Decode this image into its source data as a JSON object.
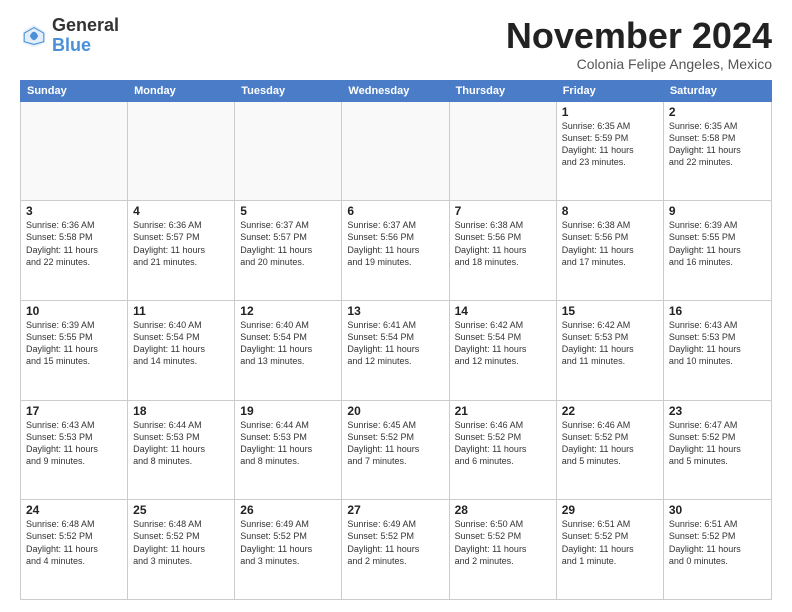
{
  "logo": {
    "general": "General",
    "blue": "Blue"
  },
  "title": "November 2024",
  "subtitle": "Colonia Felipe Angeles, Mexico",
  "days": [
    "Sunday",
    "Monday",
    "Tuesday",
    "Wednesday",
    "Thursday",
    "Friday",
    "Saturday"
  ],
  "rows": [
    [
      {
        "day": "",
        "content": "",
        "empty": true
      },
      {
        "day": "",
        "content": "",
        "empty": true
      },
      {
        "day": "",
        "content": "",
        "empty": true
      },
      {
        "day": "",
        "content": "",
        "empty": true
      },
      {
        "day": "",
        "content": "",
        "empty": true
      },
      {
        "day": "1",
        "content": "Sunrise: 6:35 AM\nSunset: 5:59 PM\nDaylight: 11 hours\nand 23 minutes.",
        "empty": false
      },
      {
        "day": "2",
        "content": "Sunrise: 6:35 AM\nSunset: 5:58 PM\nDaylight: 11 hours\nand 22 minutes.",
        "empty": false
      }
    ],
    [
      {
        "day": "3",
        "content": "Sunrise: 6:36 AM\nSunset: 5:58 PM\nDaylight: 11 hours\nand 22 minutes.",
        "empty": false
      },
      {
        "day": "4",
        "content": "Sunrise: 6:36 AM\nSunset: 5:57 PM\nDaylight: 11 hours\nand 21 minutes.",
        "empty": false
      },
      {
        "day": "5",
        "content": "Sunrise: 6:37 AM\nSunset: 5:57 PM\nDaylight: 11 hours\nand 20 minutes.",
        "empty": false
      },
      {
        "day": "6",
        "content": "Sunrise: 6:37 AM\nSunset: 5:56 PM\nDaylight: 11 hours\nand 19 minutes.",
        "empty": false
      },
      {
        "day": "7",
        "content": "Sunrise: 6:38 AM\nSunset: 5:56 PM\nDaylight: 11 hours\nand 18 minutes.",
        "empty": false
      },
      {
        "day": "8",
        "content": "Sunrise: 6:38 AM\nSunset: 5:56 PM\nDaylight: 11 hours\nand 17 minutes.",
        "empty": false
      },
      {
        "day": "9",
        "content": "Sunrise: 6:39 AM\nSunset: 5:55 PM\nDaylight: 11 hours\nand 16 minutes.",
        "empty": false
      }
    ],
    [
      {
        "day": "10",
        "content": "Sunrise: 6:39 AM\nSunset: 5:55 PM\nDaylight: 11 hours\nand 15 minutes.",
        "empty": false
      },
      {
        "day": "11",
        "content": "Sunrise: 6:40 AM\nSunset: 5:54 PM\nDaylight: 11 hours\nand 14 minutes.",
        "empty": false
      },
      {
        "day": "12",
        "content": "Sunrise: 6:40 AM\nSunset: 5:54 PM\nDaylight: 11 hours\nand 13 minutes.",
        "empty": false
      },
      {
        "day": "13",
        "content": "Sunrise: 6:41 AM\nSunset: 5:54 PM\nDaylight: 11 hours\nand 12 minutes.",
        "empty": false
      },
      {
        "day": "14",
        "content": "Sunrise: 6:42 AM\nSunset: 5:54 PM\nDaylight: 11 hours\nand 12 minutes.",
        "empty": false
      },
      {
        "day": "15",
        "content": "Sunrise: 6:42 AM\nSunset: 5:53 PM\nDaylight: 11 hours\nand 11 minutes.",
        "empty": false
      },
      {
        "day": "16",
        "content": "Sunrise: 6:43 AM\nSunset: 5:53 PM\nDaylight: 11 hours\nand 10 minutes.",
        "empty": false
      }
    ],
    [
      {
        "day": "17",
        "content": "Sunrise: 6:43 AM\nSunset: 5:53 PM\nDaylight: 11 hours\nand 9 minutes.",
        "empty": false
      },
      {
        "day": "18",
        "content": "Sunrise: 6:44 AM\nSunset: 5:53 PM\nDaylight: 11 hours\nand 8 minutes.",
        "empty": false
      },
      {
        "day": "19",
        "content": "Sunrise: 6:44 AM\nSunset: 5:53 PM\nDaylight: 11 hours\nand 8 minutes.",
        "empty": false
      },
      {
        "day": "20",
        "content": "Sunrise: 6:45 AM\nSunset: 5:52 PM\nDaylight: 11 hours\nand 7 minutes.",
        "empty": false
      },
      {
        "day": "21",
        "content": "Sunrise: 6:46 AM\nSunset: 5:52 PM\nDaylight: 11 hours\nand 6 minutes.",
        "empty": false
      },
      {
        "day": "22",
        "content": "Sunrise: 6:46 AM\nSunset: 5:52 PM\nDaylight: 11 hours\nand 5 minutes.",
        "empty": false
      },
      {
        "day": "23",
        "content": "Sunrise: 6:47 AM\nSunset: 5:52 PM\nDaylight: 11 hours\nand 5 minutes.",
        "empty": false
      }
    ],
    [
      {
        "day": "24",
        "content": "Sunrise: 6:48 AM\nSunset: 5:52 PM\nDaylight: 11 hours\nand 4 minutes.",
        "empty": false
      },
      {
        "day": "25",
        "content": "Sunrise: 6:48 AM\nSunset: 5:52 PM\nDaylight: 11 hours\nand 3 minutes.",
        "empty": false
      },
      {
        "day": "26",
        "content": "Sunrise: 6:49 AM\nSunset: 5:52 PM\nDaylight: 11 hours\nand 3 minutes.",
        "empty": false
      },
      {
        "day": "27",
        "content": "Sunrise: 6:49 AM\nSunset: 5:52 PM\nDaylight: 11 hours\nand 2 minutes.",
        "empty": false
      },
      {
        "day": "28",
        "content": "Sunrise: 6:50 AM\nSunset: 5:52 PM\nDaylight: 11 hours\nand 2 minutes.",
        "empty": false
      },
      {
        "day": "29",
        "content": "Sunrise: 6:51 AM\nSunset: 5:52 PM\nDaylight: 11 hours\nand 1 minute.",
        "empty": false
      },
      {
        "day": "30",
        "content": "Sunrise: 6:51 AM\nSunset: 5:52 PM\nDaylight: 11 hours\nand 0 minutes.",
        "empty": false
      }
    ]
  ]
}
